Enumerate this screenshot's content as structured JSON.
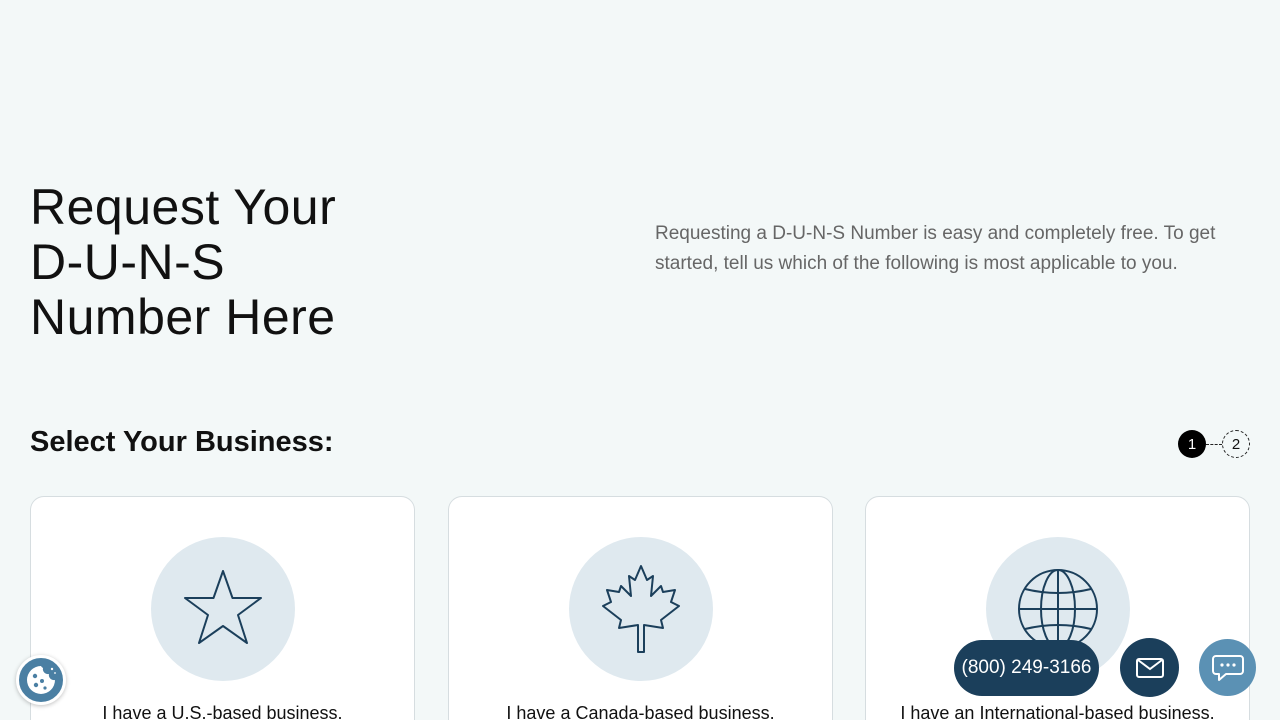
{
  "hero": {
    "title_lines": [
      "Request Your",
      "D-U-N-S",
      "Number Here"
    ],
    "description": "Requesting a D-U-N-S Number is easy and completely free. To get started, tell us which of the following is most applicable to you."
  },
  "section": {
    "title": "Select Your Business:"
  },
  "stepper": {
    "steps": [
      "1",
      "2"
    ],
    "current": 1
  },
  "cards": [
    {
      "icon": "star-icon",
      "label": "I have a U.S.-based business."
    },
    {
      "icon": "maple-leaf-icon",
      "label": "I have a Canada-based business."
    },
    {
      "icon": "globe-icon",
      "label": "I have an International-based business."
    }
  ],
  "floating": {
    "phone_label": "(800) 249-3166",
    "cookie_icon": "cookie-icon",
    "mail_icon": "mail-icon",
    "chat_icon": "chat-icon"
  },
  "colors": {
    "background": "#f3f8f8",
    "navy": "#1b3f5b",
    "icon_circle": "#dfe9ef",
    "chat_blue": "#5b91b4"
  }
}
